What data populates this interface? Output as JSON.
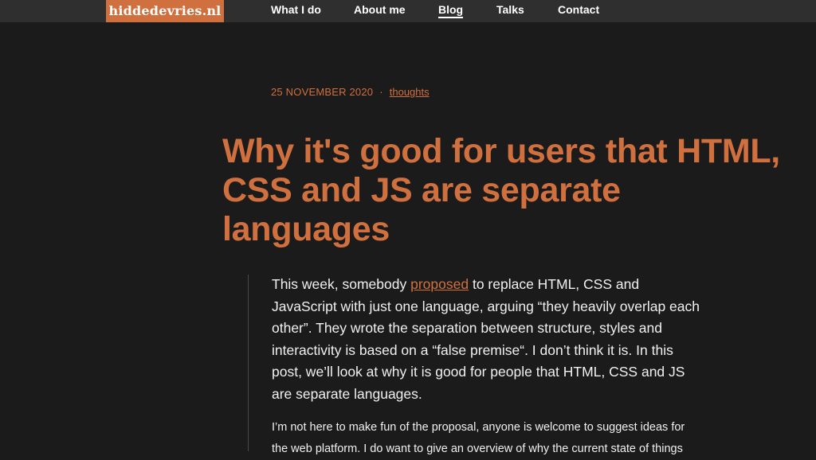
{
  "header": {
    "logo": "hiddedevries.nl",
    "nav": [
      {
        "label": "What I do"
      },
      {
        "label": "About me"
      },
      {
        "label": "Blog"
      },
      {
        "label": "Talks"
      },
      {
        "label": "Contact"
      }
    ]
  },
  "article": {
    "date": "25 NOVEMBER 2020",
    "separator": "·",
    "tag": "thoughts",
    "title": "Why it's good for users that HTML, CSS and JS are separate languages",
    "lead": {
      "before_link": "This week, somebody ",
      "link_text": "proposed",
      "after_link": " to replace HTML, CSS and JavaScript with just one language, arguing “they heavily overlap each other”. They wrote the separation between structure, styles and interactivity is based on a “false premise“. I don’t think it is. In this post, we’ll look at why it is good for people that HTML, CSS and JS are separate languages."
    },
    "paragraph": "I’m not here to make fun of the proposal, anyone is welcome to suggest ideas for the web platform. I do want to give an overview of why the current state of things"
  },
  "colors": {
    "background": "#1b1b1b",
    "topbar": "#2f2f2f",
    "accent": "#d0703f",
    "text": "#f0f0f0"
  }
}
